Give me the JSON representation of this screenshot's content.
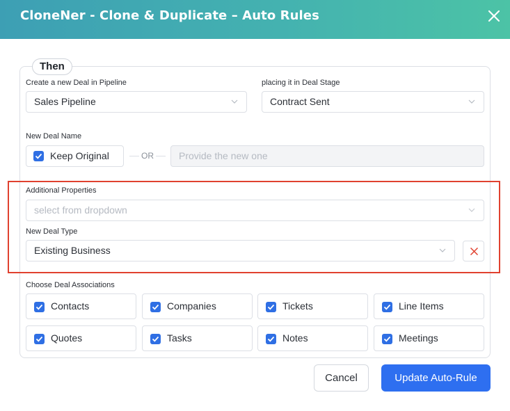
{
  "header": {
    "title": "CloneNer - Clone & Duplicate – Auto Rules",
    "close_icon": "close-icon"
  },
  "section": {
    "legend": "Then",
    "pipeline": {
      "label": "Create a new Deal in Pipeline",
      "value": "Sales Pipeline"
    },
    "stage": {
      "label": "placing it in Deal Stage",
      "value": "Contract Sent"
    },
    "deal_name": {
      "label": "New Deal Name",
      "keep_original_label": "Keep Original",
      "keep_original_checked": true,
      "or_text": "OR",
      "new_name_placeholder": "Provide the new one"
    },
    "additional_properties": {
      "label": "Additional Properties",
      "placeholder": "select from dropdown"
    },
    "deal_type": {
      "label": "New Deal Type",
      "value": "Existing Business"
    },
    "associations": {
      "label": "Choose Deal Associations",
      "items": [
        {
          "label": "Contacts",
          "checked": true
        },
        {
          "label": "Companies",
          "checked": true
        },
        {
          "label": "Tickets",
          "checked": true
        },
        {
          "label": "Line Items",
          "checked": true
        },
        {
          "label": "Quotes",
          "checked": true
        },
        {
          "label": "Tasks",
          "checked": true
        },
        {
          "label": "Notes",
          "checked": true
        },
        {
          "label": "Meetings",
          "checked": true
        }
      ]
    }
  },
  "footer": {
    "cancel_label": "Cancel",
    "update_label": "Update Auto-Rule"
  },
  "colors": {
    "accent": "#2e6ff0",
    "highlight": "#e0412f",
    "header_start": "#3d9fb4",
    "header_end": "#4cc3a6"
  }
}
